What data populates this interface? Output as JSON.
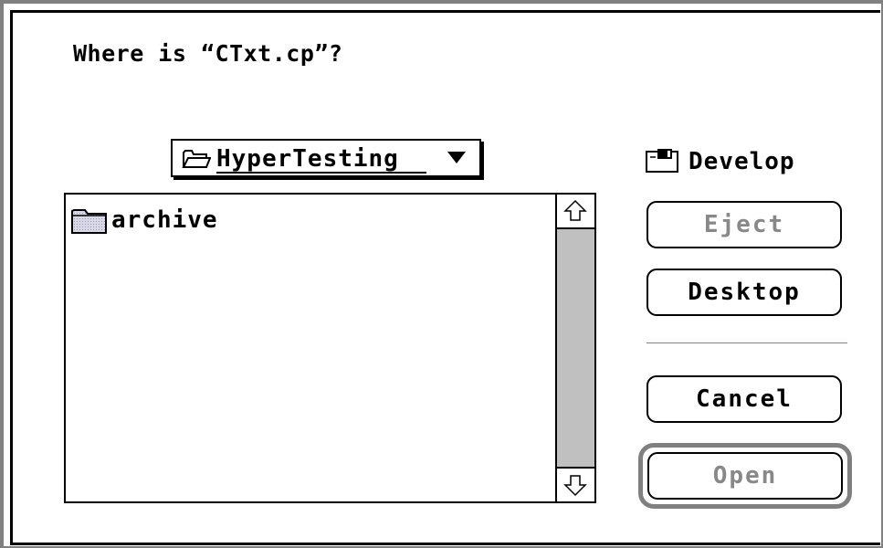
{
  "dialog": {
    "prompt": "Where is “CTxt.cp”?"
  },
  "folder_popup": {
    "label": "HyperTesting",
    "icon": "open-folder-icon",
    "arrow_icon": "triangle-down-icon"
  },
  "file_list": {
    "items": [
      {
        "label": "archive",
        "icon": "folder-icon"
      }
    ]
  },
  "volume": {
    "label": "Develop",
    "icon": "disk-icon"
  },
  "buttons": {
    "eject": "Eject",
    "desktop": "Desktop",
    "cancel": "Cancel",
    "open": "Open"
  },
  "colors": {
    "frame": "#808080",
    "scroll_track": "#c0c0c0",
    "disabled_text": "#888888"
  }
}
